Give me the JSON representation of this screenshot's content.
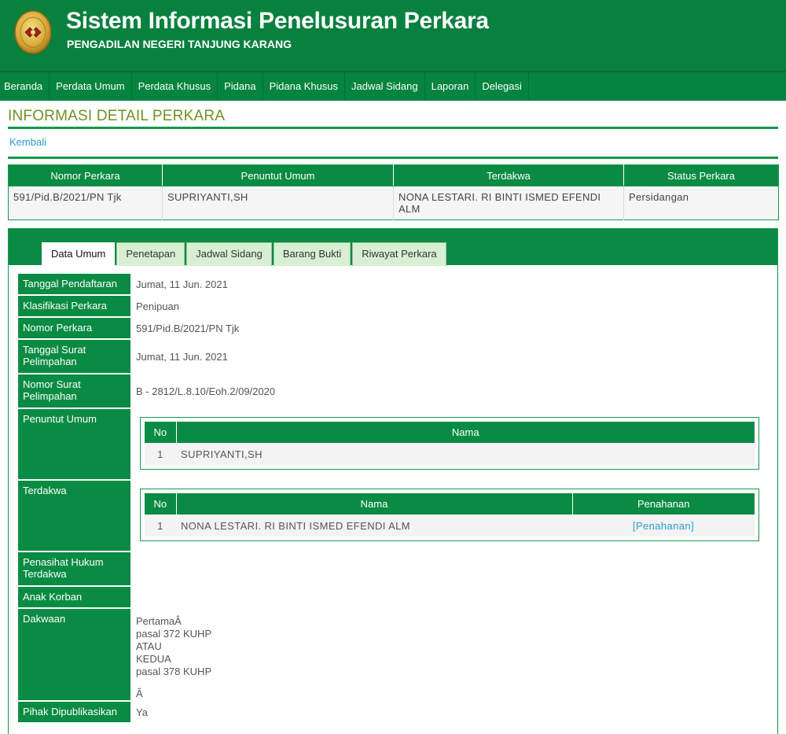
{
  "header": {
    "title": "Sistem Informasi Penelusuran Perkara",
    "subtitle": "PENGADILAN NEGERI TANJUNG KARANG"
  },
  "nav": [
    "Beranda",
    "Perdata Umum",
    "Perdata Khusus",
    "Pidana",
    "Pidana Khusus",
    "Jadwal Sidang",
    "Laporan",
    "Delegasi"
  ],
  "page_title": "INFORMASI DETAIL PERKARA",
  "back_label": "Kembali",
  "summary": {
    "headers": [
      "Nomor Perkara",
      "Penuntut Umum",
      "Terdakwa",
      "Status Perkara"
    ],
    "row": [
      "591/Pid.B/2021/PN Tjk",
      "SUPRIYANTI,SH",
      "NONA LESTARI. RI BINTI ISMED EFENDI ALM",
      "Persidangan"
    ]
  },
  "tabs": [
    "Data Umum",
    "Penetapan",
    "Jadwal Sidang",
    "Barang Bukti",
    "Riwayat Perkara"
  ],
  "active_tab": "Data Umum",
  "details": {
    "tanggal_pendaftaran": {
      "label": "Tanggal Pendaftaran",
      "value": "Jumat, 11 Jun. 2021"
    },
    "klasifikasi": {
      "label": "Klasifikasi Perkara",
      "value": "Penipuan"
    },
    "nomor_perkara": {
      "label": "Nomor Perkara",
      "value": "591/Pid.B/2021/PN Tjk"
    },
    "tanggal_surat": {
      "label": "Tanggal Surat Pelimpahan",
      "value": "Jumat, 11 Jun. 2021"
    },
    "nomor_surat": {
      "label": "Nomor Surat Pelimpahan",
      "value": "B - 2812/L.8.10/Eoh.2/09/2020"
    },
    "penuntut_umum": {
      "label": "Penuntut Umum",
      "table_headers": [
        "No",
        "Nama"
      ],
      "rows": [
        [
          "1",
          "SUPRIYANTI,SH"
        ]
      ]
    },
    "terdakwa": {
      "label": "Terdakwa",
      "table_headers": [
        "No",
        "Nama",
        "Penahanan"
      ],
      "rows": [
        [
          "1",
          "NONA LESTARI. RI BINTI ISMED EFENDI ALM",
          "Penahanan"
        ]
      ]
    },
    "penasihat": {
      "label": "Penasihat Hukum Terdakwa",
      "value": ""
    },
    "anak_korban": {
      "label": "Anak Korban",
      "value": ""
    },
    "dakwaan": {
      "label": "Dakwaan",
      "lines": [
        "PertamaÂ",
        "pasal 372 KUHP",
        "ATAU",
        "KEDUA",
        "pasal 378 KUHP",
        "",
        "Â"
      ]
    },
    "pihak": {
      "label": "Pihak Dipublikasikan",
      "value": "Ya"
    }
  },
  "colors": {
    "brand_green": "#08803e",
    "title_olive": "#6f9225",
    "link_blue": "#2a9bd1",
    "tab_inactive": "#d8efd4"
  }
}
